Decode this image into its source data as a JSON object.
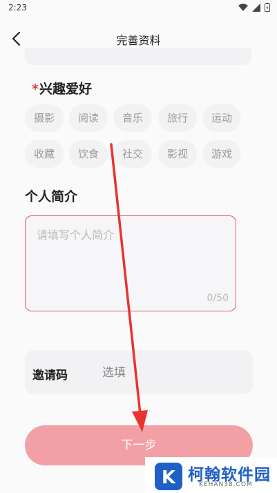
{
  "status": {
    "time": "2:23"
  },
  "header": {
    "title": "完善资料"
  },
  "hobbies": {
    "required_mark": "*",
    "title": "兴趣爱好",
    "tags": [
      "摄影",
      "阅读",
      "音乐",
      "旅行",
      "运动",
      "收藏",
      "饮食",
      "社交",
      "影视",
      "游戏"
    ]
  },
  "intro": {
    "title": "个人简介",
    "placeholder": "请填写个人简介",
    "value": "",
    "counter": "0/50"
  },
  "invite": {
    "label": "邀请码",
    "placeholder": "选填",
    "value": ""
  },
  "next_button": {
    "label": "下一步"
  },
  "watermark": {
    "brand": "柯翰软件园",
    "site": "KEHAN38.COM",
    "logo_letter": "K"
  },
  "colors": {
    "accent": "#e05a64",
    "button": "#f2a0a6",
    "required": "#e23a3a",
    "arrow": "#e8332f"
  }
}
